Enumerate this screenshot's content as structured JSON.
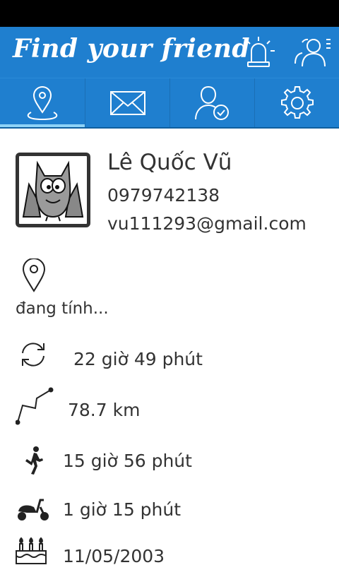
{
  "app": {
    "title": "Find your friend"
  },
  "tabs": [
    {
      "name": "location",
      "icon": "location-pin-icon",
      "active": true
    },
    {
      "name": "messages",
      "icon": "envelope-icon",
      "active": false
    },
    {
      "name": "profile",
      "icon": "user-check-icon",
      "active": false
    },
    {
      "name": "settings",
      "icon": "gear-icon",
      "active": false
    }
  ],
  "profile": {
    "name": "Lê Quốc Vũ",
    "phone": "0979742138",
    "email": "vu111293@gmail.com"
  },
  "location": {
    "status": "đang tính..."
  },
  "stats": {
    "update_interval": "22 giờ 49 phút",
    "distance": "78.7 km",
    "walking_time": "15 giờ 56 phút",
    "riding_time": "1 giờ 15 phút",
    "birthday": "11/05/2003"
  },
  "colors": {
    "primary": "#1f7fcf",
    "indicator": "#8fd3f7",
    "status_bar": "#000000"
  }
}
